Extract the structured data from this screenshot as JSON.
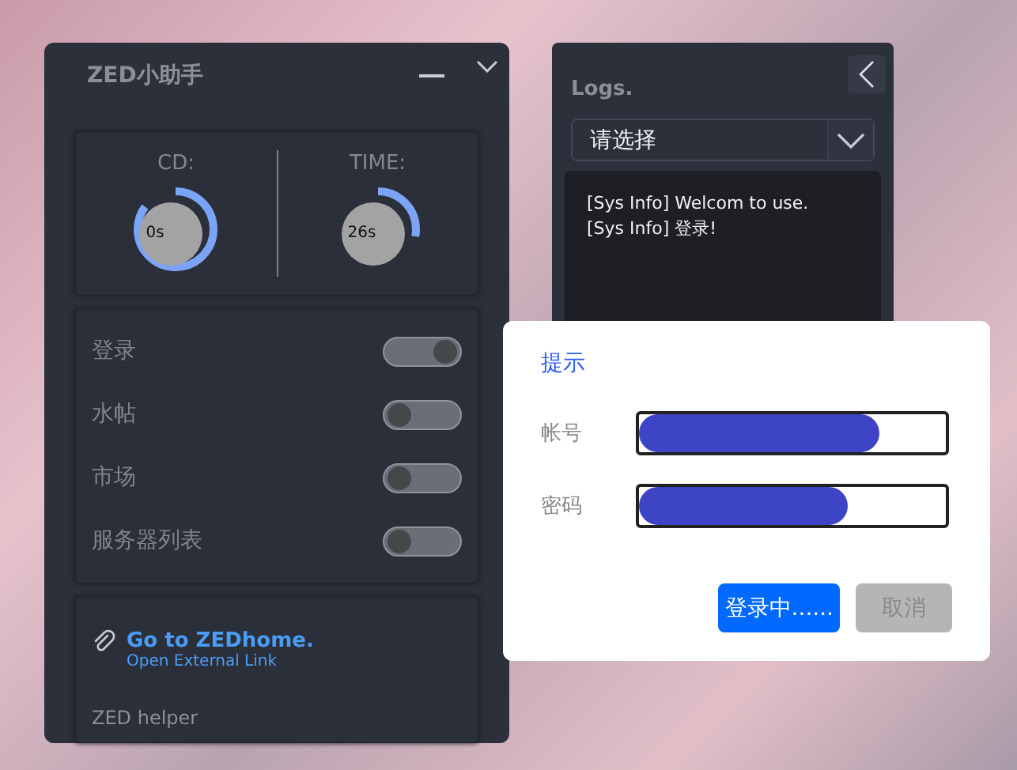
{
  "helper_window": {
    "title": "ZED小助手",
    "timers": [
      {
        "label": "CD:",
        "reading": "0s",
        "level": 0.85
      },
      {
        "label": "TIME:",
        "reading": "26s",
        "level": 0.28
      }
    ],
    "switches": [
      {
        "label": "登录",
        "on": true
      },
      {
        "label": "水帖",
        "on": false
      },
      {
        "label": "市场",
        "on": false
      },
      {
        "label": "服务器列表",
        "on": false
      }
    ],
    "link": {
      "title": "Go to ZEDhome.",
      "subtitle": "Open External Link"
    },
    "footer": "ZED helper"
  },
  "logs_window": {
    "title": "Logs.",
    "select": {
      "placeholder": "请选择"
    },
    "lines": [
      "[Sys Info] Welcom to use.",
      "[Sys Info] 登录!"
    ]
  },
  "dialog": {
    "title": "提示",
    "fields": [
      {
        "label": "帐号",
        "redacted": true
      },
      {
        "label": "密码",
        "redacted": true
      }
    ],
    "buttons": [
      {
        "label": "登录中......",
        "kind": "primary"
      },
      {
        "label": "取消",
        "kind": "disabled"
      }
    ]
  }
}
